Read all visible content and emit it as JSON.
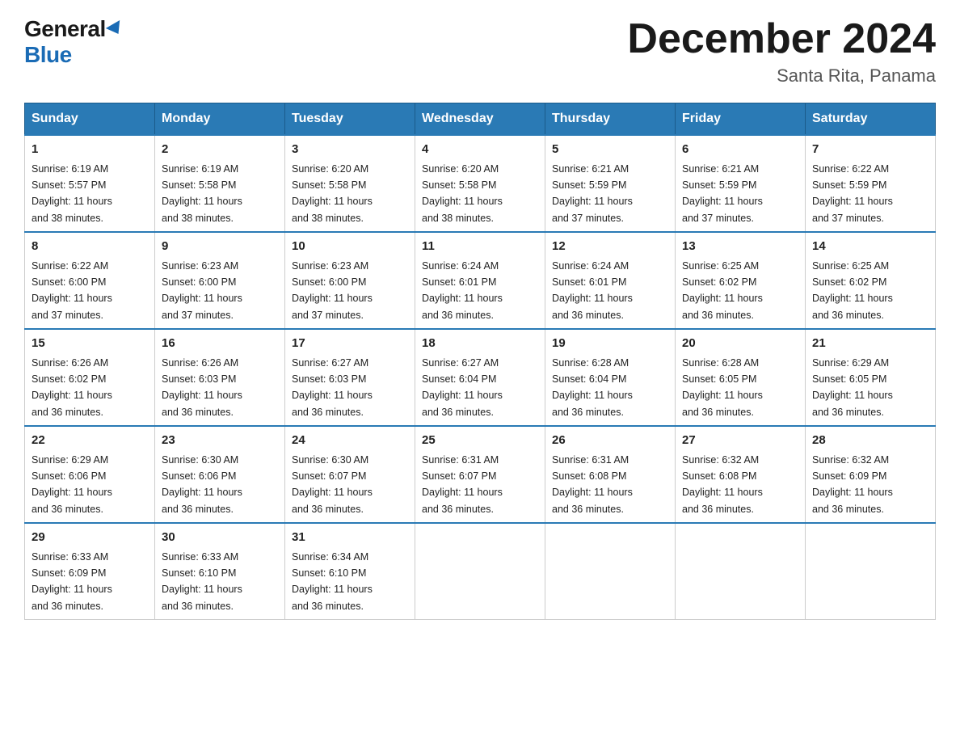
{
  "header": {
    "logo_general": "General",
    "logo_blue": "Blue",
    "title": "December 2024",
    "subtitle": "Santa Rita, Panama"
  },
  "days_of_week": [
    "Sunday",
    "Monday",
    "Tuesday",
    "Wednesday",
    "Thursday",
    "Friday",
    "Saturday"
  ],
  "weeks": [
    [
      {
        "num": "1",
        "sunrise": "6:19 AM",
        "sunset": "5:57 PM",
        "daylight": "11 hours and 38 minutes."
      },
      {
        "num": "2",
        "sunrise": "6:19 AM",
        "sunset": "5:58 PM",
        "daylight": "11 hours and 38 minutes."
      },
      {
        "num": "3",
        "sunrise": "6:20 AM",
        "sunset": "5:58 PM",
        "daylight": "11 hours and 38 minutes."
      },
      {
        "num": "4",
        "sunrise": "6:20 AM",
        "sunset": "5:58 PM",
        "daylight": "11 hours and 38 minutes."
      },
      {
        "num": "5",
        "sunrise": "6:21 AM",
        "sunset": "5:59 PM",
        "daylight": "11 hours and 37 minutes."
      },
      {
        "num": "6",
        "sunrise": "6:21 AM",
        "sunset": "5:59 PM",
        "daylight": "11 hours and 37 minutes."
      },
      {
        "num": "7",
        "sunrise": "6:22 AM",
        "sunset": "5:59 PM",
        "daylight": "11 hours and 37 minutes."
      }
    ],
    [
      {
        "num": "8",
        "sunrise": "6:22 AM",
        "sunset": "6:00 PM",
        "daylight": "11 hours and 37 minutes."
      },
      {
        "num": "9",
        "sunrise": "6:23 AM",
        "sunset": "6:00 PM",
        "daylight": "11 hours and 37 minutes."
      },
      {
        "num": "10",
        "sunrise": "6:23 AM",
        "sunset": "6:00 PM",
        "daylight": "11 hours and 37 minutes."
      },
      {
        "num": "11",
        "sunrise": "6:24 AM",
        "sunset": "6:01 PM",
        "daylight": "11 hours and 36 minutes."
      },
      {
        "num": "12",
        "sunrise": "6:24 AM",
        "sunset": "6:01 PM",
        "daylight": "11 hours and 36 minutes."
      },
      {
        "num": "13",
        "sunrise": "6:25 AM",
        "sunset": "6:02 PM",
        "daylight": "11 hours and 36 minutes."
      },
      {
        "num": "14",
        "sunrise": "6:25 AM",
        "sunset": "6:02 PM",
        "daylight": "11 hours and 36 minutes."
      }
    ],
    [
      {
        "num": "15",
        "sunrise": "6:26 AM",
        "sunset": "6:02 PM",
        "daylight": "11 hours and 36 minutes."
      },
      {
        "num": "16",
        "sunrise": "6:26 AM",
        "sunset": "6:03 PM",
        "daylight": "11 hours and 36 minutes."
      },
      {
        "num": "17",
        "sunrise": "6:27 AM",
        "sunset": "6:03 PM",
        "daylight": "11 hours and 36 minutes."
      },
      {
        "num": "18",
        "sunrise": "6:27 AM",
        "sunset": "6:04 PM",
        "daylight": "11 hours and 36 minutes."
      },
      {
        "num": "19",
        "sunrise": "6:28 AM",
        "sunset": "6:04 PM",
        "daylight": "11 hours and 36 minutes."
      },
      {
        "num": "20",
        "sunrise": "6:28 AM",
        "sunset": "6:05 PM",
        "daylight": "11 hours and 36 minutes."
      },
      {
        "num": "21",
        "sunrise": "6:29 AM",
        "sunset": "6:05 PM",
        "daylight": "11 hours and 36 minutes."
      }
    ],
    [
      {
        "num": "22",
        "sunrise": "6:29 AM",
        "sunset": "6:06 PM",
        "daylight": "11 hours and 36 minutes."
      },
      {
        "num": "23",
        "sunrise": "6:30 AM",
        "sunset": "6:06 PM",
        "daylight": "11 hours and 36 minutes."
      },
      {
        "num": "24",
        "sunrise": "6:30 AM",
        "sunset": "6:07 PM",
        "daylight": "11 hours and 36 minutes."
      },
      {
        "num": "25",
        "sunrise": "6:31 AM",
        "sunset": "6:07 PM",
        "daylight": "11 hours and 36 minutes."
      },
      {
        "num": "26",
        "sunrise": "6:31 AM",
        "sunset": "6:08 PM",
        "daylight": "11 hours and 36 minutes."
      },
      {
        "num": "27",
        "sunrise": "6:32 AM",
        "sunset": "6:08 PM",
        "daylight": "11 hours and 36 minutes."
      },
      {
        "num": "28",
        "sunrise": "6:32 AM",
        "sunset": "6:09 PM",
        "daylight": "11 hours and 36 minutes."
      }
    ],
    [
      {
        "num": "29",
        "sunrise": "6:33 AM",
        "sunset": "6:09 PM",
        "daylight": "11 hours and 36 minutes."
      },
      {
        "num": "30",
        "sunrise": "6:33 AM",
        "sunset": "6:10 PM",
        "daylight": "11 hours and 36 minutes."
      },
      {
        "num": "31",
        "sunrise": "6:34 AM",
        "sunset": "6:10 PM",
        "daylight": "11 hours and 36 minutes."
      },
      null,
      null,
      null,
      null
    ]
  ],
  "labels": {
    "sunrise": "Sunrise:",
    "sunset": "Sunset:",
    "daylight": "Daylight:"
  }
}
